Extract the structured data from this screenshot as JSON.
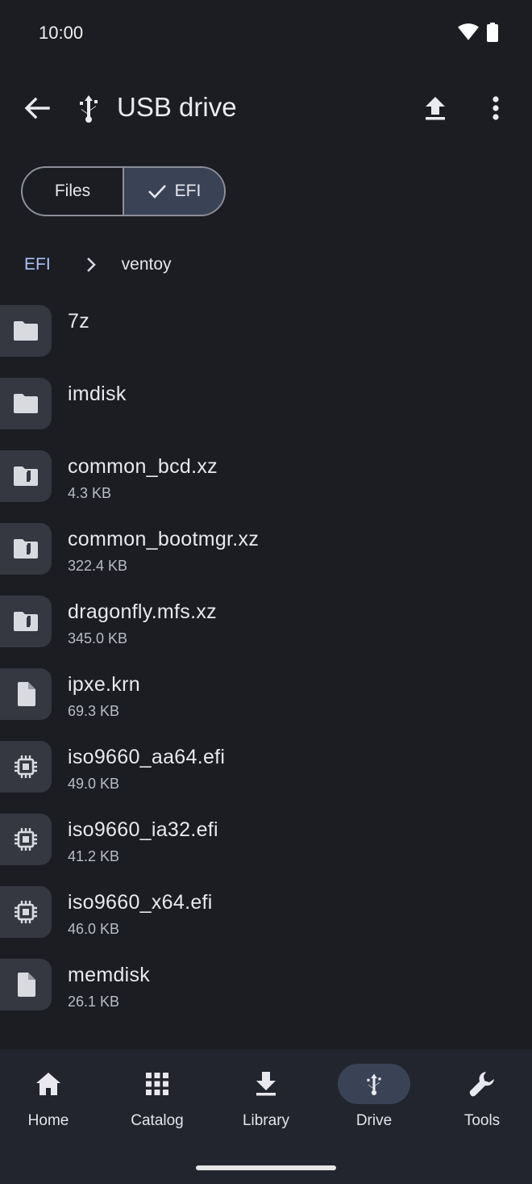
{
  "status": {
    "time": "10:00"
  },
  "header": {
    "title": "USB drive"
  },
  "segments": [
    {
      "label": "Files",
      "selected": false
    },
    {
      "label": "EFI",
      "selected": true
    }
  ],
  "breadcrumb": {
    "root": "EFI",
    "current": "ventoy"
  },
  "files": [
    {
      "name": "7z",
      "size": "",
      "icon": "folder-icon"
    },
    {
      "name": "imdisk",
      "size": "",
      "icon": "folder-icon"
    },
    {
      "name": "common_bcd.xz",
      "size": "4.3 KB",
      "icon": "archive-file-icon"
    },
    {
      "name": "common_bootmgr.xz",
      "size": "322.4 KB",
      "icon": "archive-file-icon"
    },
    {
      "name": "dragonfly.mfs.xz",
      "size": "345.0 KB",
      "icon": "archive-file-icon"
    },
    {
      "name": "ipxe.krn",
      "size": "69.3 KB",
      "icon": "file-icon"
    },
    {
      "name": "iso9660_aa64.efi",
      "size": "49.0 KB",
      "icon": "chip-icon"
    },
    {
      "name": "iso9660_ia32.efi",
      "size": "41.2 KB",
      "icon": "chip-icon"
    },
    {
      "name": "iso9660_x64.efi",
      "size": "46.0 KB",
      "icon": "chip-icon"
    },
    {
      "name": "memdisk",
      "size": "26.1 KB",
      "icon": "file-icon"
    }
  ],
  "nav": [
    {
      "label": "Home",
      "icon": "home-icon",
      "active": false
    },
    {
      "label": "Catalog",
      "icon": "grid-icon",
      "active": false
    },
    {
      "label": "Library",
      "icon": "download-icon",
      "active": false
    },
    {
      "label": "Drive",
      "icon": "usb-icon",
      "active": true
    },
    {
      "label": "Tools",
      "icon": "wrench-icon",
      "active": false
    }
  ],
  "colors": {
    "background": "#1b1d22",
    "accent": "#a9c3f5",
    "selected": "#3a4356"
  }
}
